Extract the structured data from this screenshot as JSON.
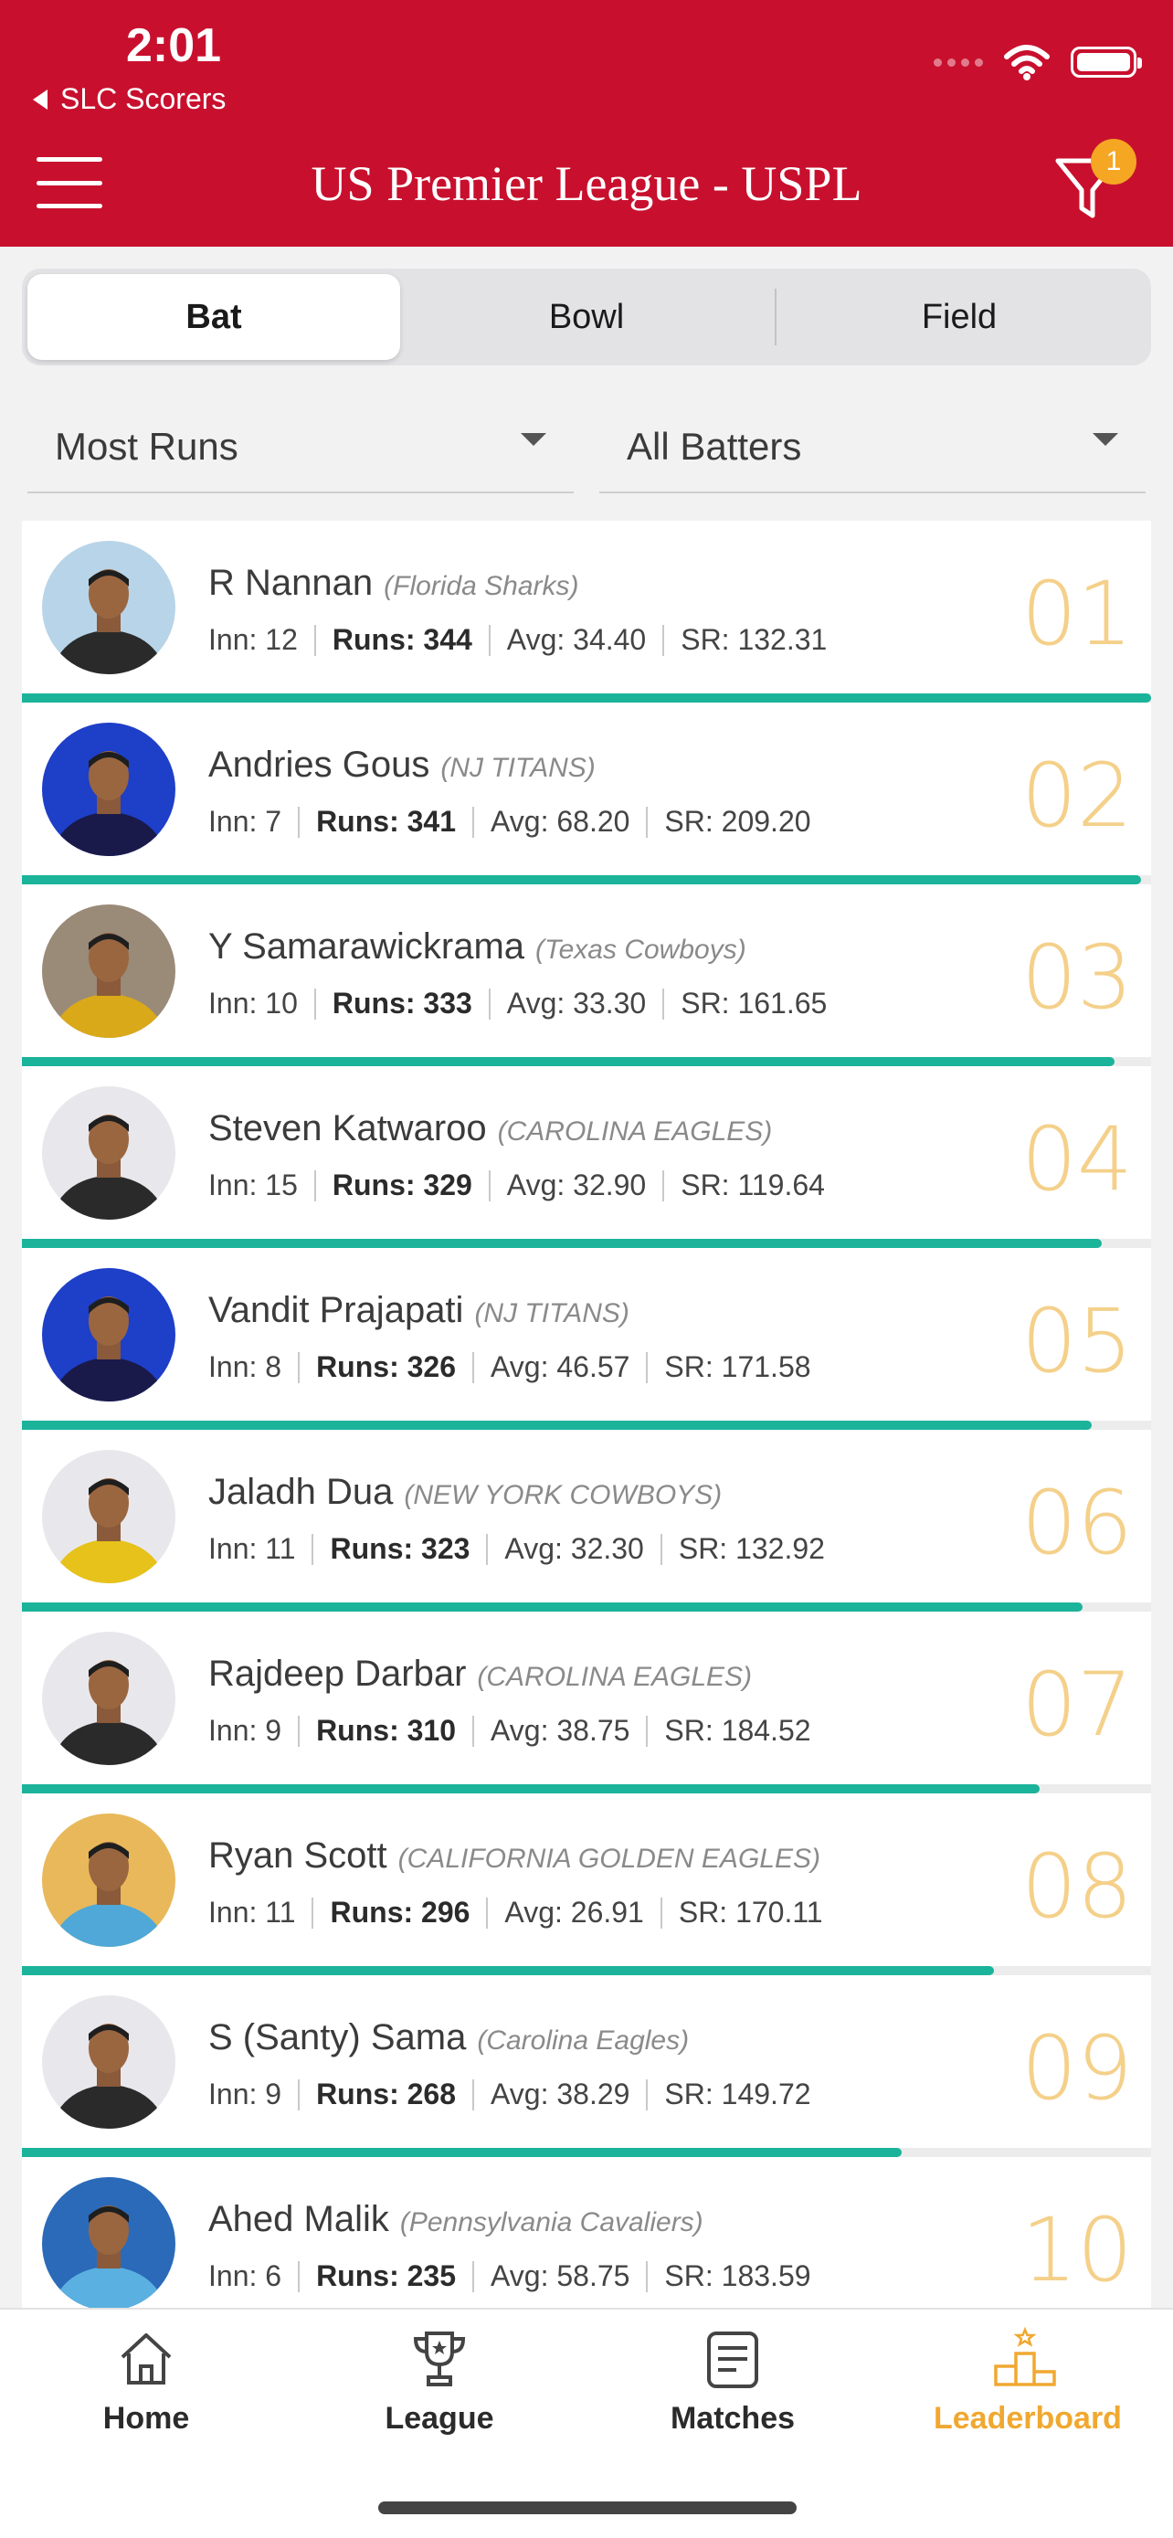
{
  "status_bar": {
    "time": "2:01",
    "back_app": "SLC Scorers"
  },
  "header": {
    "title": "US Premier League - USPL",
    "filter_badge": "1"
  },
  "tabs": [
    {
      "label": "Bat",
      "active": true
    },
    {
      "label": "Bowl",
      "active": false
    },
    {
      "label": "Field",
      "active": false
    }
  ],
  "filters": {
    "stat": "Most Runs",
    "group": "All Batters"
  },
  "players": [
    {
      "name": "R Nannan",
      "team": "(Florida Sharks)",
      "inn": "Inn: 12",
      "runs": "Runs: 344",
      "avg": "Avg: 34.40",
      "sr": "SR: 132.31",
      "rank": "01",
      "runs_value": 344,
      "photo_bg": "#b8d4e8",
      "jersey": "#2a2a2a"
    },
    {
      "name": "Andries Gous",
      "team": "(NJ TITANS)",
      "inn": "Inn: 7",
      "runs": "Runs: 341",
      "avg": "Avg: 68.20",
      "sr": "SR: 209.20",
      "rank": "02",
      "runs_value": 341,
      "photo_bg": "#1e3fc8",
      "jersey": "#1a1a4a"
    },
    {
      "name": "Y Samarawickrama",
      "team": "(Texas Cowboys)",
      "inn": "Inn: 10",
      "runs": "Runs: 333",
      "avg": "Avg: 33.30",
      "sr": "SR: 161.65",
      "rank": "03",
      "runs_value": 333,
      "photo_bg": "#9a8a78",
      "jersey": "#d9a91a"
    },
    {
      "name": "Steven Katwaroo",
      "team": "(CAROLINA EAGLES)",
      "inn": "Inn: 15",
      "runs": "Runs: 329",
      "avg": "Avg: 32.90",
      "sr": "SR: 119.64",
      "rank": "04",
      "runs_value": 329,
      "photo_bg": "#e8e8ec",
      "jersey": "#2a2a2a"
    },
    {
      "name": "Vandit Prajapati",
      "team": "(NJ TITANS)",
      "inn": "Inn: 8",
      "runs": "Runs: 326",
      "avg": "Avg: 46.57",
      "sr": "SR: 171.58",
      "rank": "05",
      "runs_value": 326,
      "photo_bg": "#1e3fc8",
      "jersey": "#1a1a4a"
    },
    {
      "name": "Jaladh Dua",
      "team": "(NEW YORK COWBOYS)",
      "inn": "Inn: 11",
      "runs": "Runs: 323",
      "avg": "Avg: 32.30",
      "sr": "SR: 132.92",
      "rank": "06",
      "runs_value": 323,
      "photo_bg": "#e8e8ec",
      "jersey": "#e6c21a"
    },
    {
      "name": "Rajdeep Darbar",
      "team": "(CAROLINA EAGLES)",
      "inn": "Inn: 9",
      "runs": "Runs: 310",
      "avg": "Avg: 38.75",
      "sr": "SR: 184.52",
      "rank": "07",
      "runs_value": 310,
      "photo_bg": "#e8e8ec",
      "jersey": "#2a2a2a"
    },
    {
      "name": "Ryan Scott",
      "team": "(CALIFORNIA GOLDEN EAGLES)",
      "inn": "Inn: 11",
      "runs": "Runs: 296",
      "avg": "Avg: 26.91",
      "sr": "SR: 170.11",
      "rank": "08",
      "runs_value": 296,
      "photo_bg": "#e8b85a",
      "jersey": "#4fa8d8"
    },
    {
      "name": "S (Santy) Sama",
      "team": "(Carolina Eagles)",
      "inn": "Inn: 9",
      "runs": "Runs: 268",
      "avg": "Avg: 38.29",
      "sr": "SR: 149.72",
      "rank": "09",
      "runs_value": 268,
      "photo_bg": "#e8e8ec",
      "jersey": "#2a2a2a"
    },
    {
      "name": "Ahed Malik",
      "team": "(Pennsylvania Cavaliers)",
      "inn": "Inn: 6",
      "runs": "Runs: 235",
      "avg": "Avg: 58.75",
      "sr": "SR: 183.59",
      "rank": "10",
      "runs_value": 235,
      "photo_bg": "#2a6ab8",
      "jersey": "#5ab0e0"
    }
  ],
  "tab_bar": [
    {
      "label": "Home",
      "icon": "home-icon",
      "active": false
    },
    {
      "label": "League",
      "icon": "trophy-icon",
      "active": false
    },
    {
      "label": "Matches",
      "icon": "scorecard-icon",
      "active": false
    },
    {
      "label": "Leaderboard",
      "icon": "podium-icon",
      "active": true
    }
  ],
  "colors": {
    "header_red": "#c8102e",
    "progress_teal": "#1bb39a",
    "rank_gold": "#f4d08a",
    "active_tab": "#f0a830",
    "badge_orange": "#f5a623"
  }
}
